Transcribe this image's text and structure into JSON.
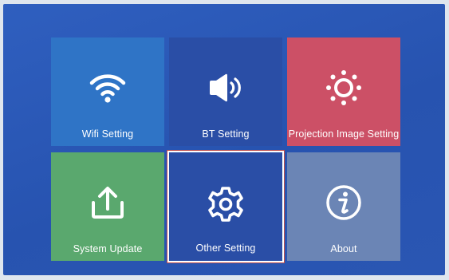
{
  "menu": {
    "tiles": [
      {
        "label": "Wifi Setting",
        "icon": "wifi-icon",
        "color": "#2f74c6"
      },
      {
        "label": "BT Setting",
        "icon": "speaker-icon",
        "color": "#2a4ea6"
      },
      {
        "label": "Projection Image Setting",
        "icon": "brightness-icon",
        "color": "#cc5066"
      },
      {
        "label": "System Update",
        "icon": "upload-icon",
        "color": "#5aa86e"
      },
      {
        "label": "Other Setting",
        "icon": "gear-icon",
        "color": "#2a4ea6",
        "selected": true
      },
      {
        "label": "About",
        "icon": "info-icon",
        "color": "#6b85b5"
      }
    ]
  }
}
